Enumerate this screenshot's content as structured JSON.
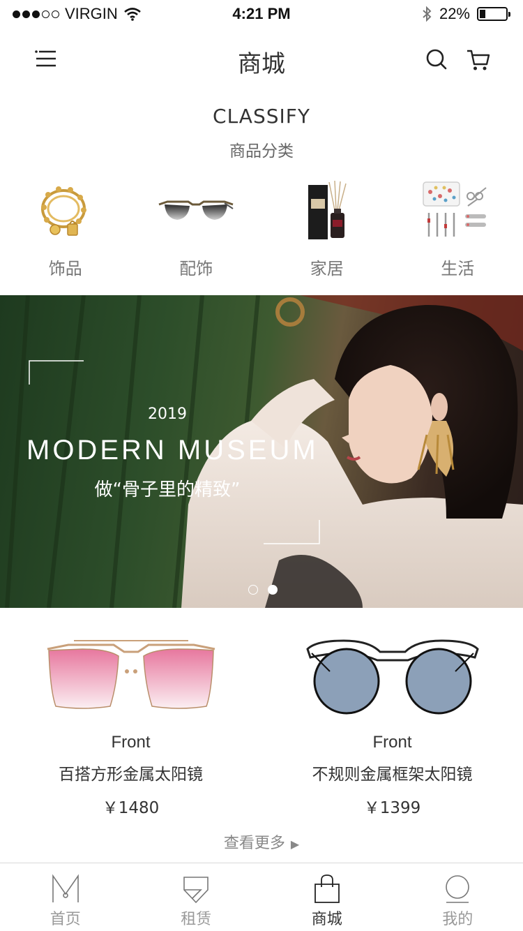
{
  "status": {
    "carrier": "VIRGIN",
    "time": "4:21 PM",
    "battery": "22%",
    "battery_level": 0.22
  },
  "nav": {
    "title": "商城"
  },
  "classify": {
    "title_en": "CLASSIFY",
    "title_zh": "商品分类",
    "items": [
      {
        "label": "饰品",
        "icon": "bracelet-icon"
      },
      {
        "label": "配饰",
        "icon": "sunglasses-icon"
      },
      {
        "label": "家居",
        "icon": "diffuser-icon"
      },
      {
        "label": "生活",
        "icon": "manicure-set-icon"
      }
    ]
  },
  "banner": {
    "year": "2019",
    "title": "MODERN MUSEUM",
    "subtitle": "做“骨子里的精致”",
    "slides": 2,
    "active_slide": 2
  },
  "products": [
    {
      "brand": "Front",
      "name": "百搭方形金属太阳镜",
      "price": "￥1480",
      "icon": "pink-square-sunglasses-icon"
    },
    {
      "brand": "Front",
      "name": "不规则金属框架太阳镜",
      "price": "￥1399",
      "icon": "blue-round-sunglasses-icon"
    }
  ],
  "more": {
    "label": "查看更多",
    "arrow": "▶"
  },
  "tabbar": [
    {
      "label": "首页",
      "icon": "home-icon",
      "active": false
    },
    {
      "label": "租赁",
      "icon": "rent-icon",
      "active": false
    },
    {
      "label": "商城",
      "icon": "shopping-bag-icon",
      "active": true
    },
    {
      "label": "我的",
      "icon": "profile-icon",
      "active": false
    }
  ]
}
